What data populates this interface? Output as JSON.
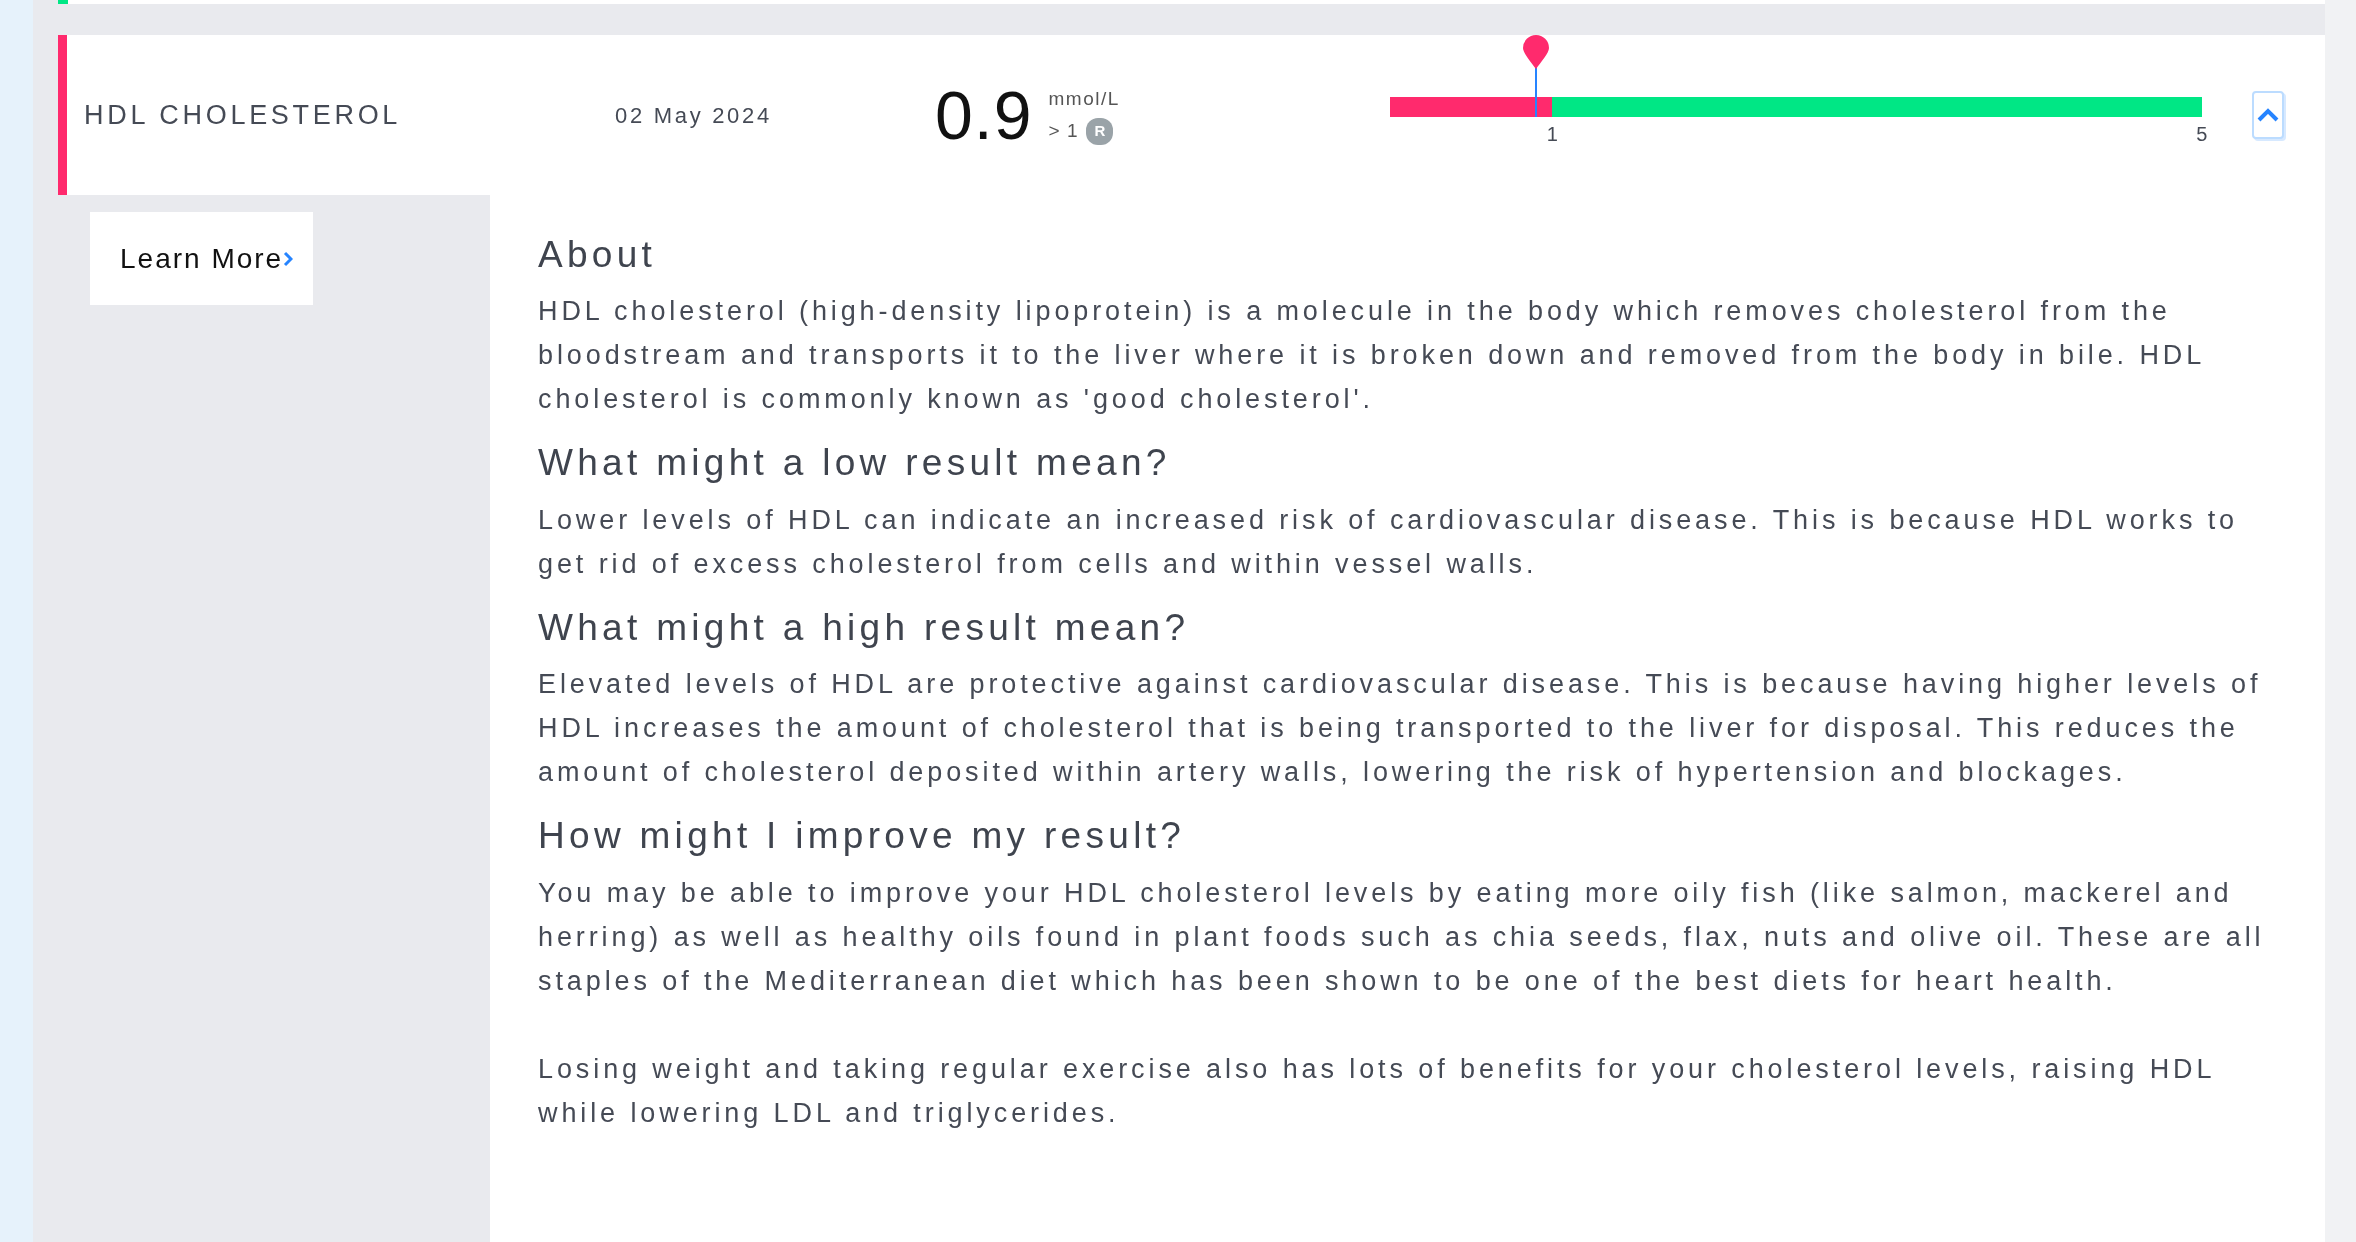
{
  "result": {
    "name": "HDL CHOLESTEROL",
    "date": "02 May 2024",
    "value": "0.9",
    "unit": "mmol/L",
    "reference": "> 1",
    "reference_badge": "R",
    "expanded": true,
    "range_bar": {
      "level": 0.18,
      "zones": [
        {
          "color": "#ff2a6d"
        },
        {
          "color": "#00e785"
        }
      ],
      "tick_labels": [
        "1",
        "5"
      ]
    }
  },
  "sidebar": {
    "items": [
      {
        "label": "Learn More",
        "selected": true
      }
    ]
  },
  "content": [
    {
      "kind": "heading",
      "text": "About"
    },
    {
      "kind": "paragraph",
      "text": "HDL cholesterol (high-density lipoprotein) is a molecule in the body which removes cholesterol from the bloodstream and transports it to the liver where it is broken down and removed from the body in bile. HDL cholesterol is commonly known as 'good cholesterol'."
    },
    {
      "kind": "heading",
      "text": "What might a low result mean?"
    },
    {
      "kind": "paragraph",
      "text": "Lower levels of HDL can indicate an increased risk of cardiovascular disease. This is because HDL works to get rid of excess cholesterol from cells and within vessel walls."
    },
    {
      "kind": "heading",
      "text": "What might a high result mean?"
    },
    {
      "kind": "paragraph",
      "text": "Elevated levels of HDL are protective against cardiovascular disease. This is because having higher levels of HDL increases the amount of cholesterol that is being transported to the liver for disposal. This reduces the amount of cholesterol deposited within artery walls, lowering the risk of hypertension and blockages."
    },
    {
      "kind": "heading",
      "text": "How might I improve my result?"
    },
    {
      "kind": "paragraph",
      "text": "You may be able to improve your HDL cholesterol levels by eating more oily fish (like salmon, mackerel and herring) as well as healthy oils found in plant foods such as chia seeds, flax, nuts and olive oil. These are all staples of the Mediterranean diet which has been shown to be one of the best diets for heart health."
    },
    {
      "kind": "paragraph",
      "text": "Losing weight and taking regular exercise also has lots of benefits for your cholesterol levels, raising HDL while lowering LDL and triglycerides."
    }
  ]
}
